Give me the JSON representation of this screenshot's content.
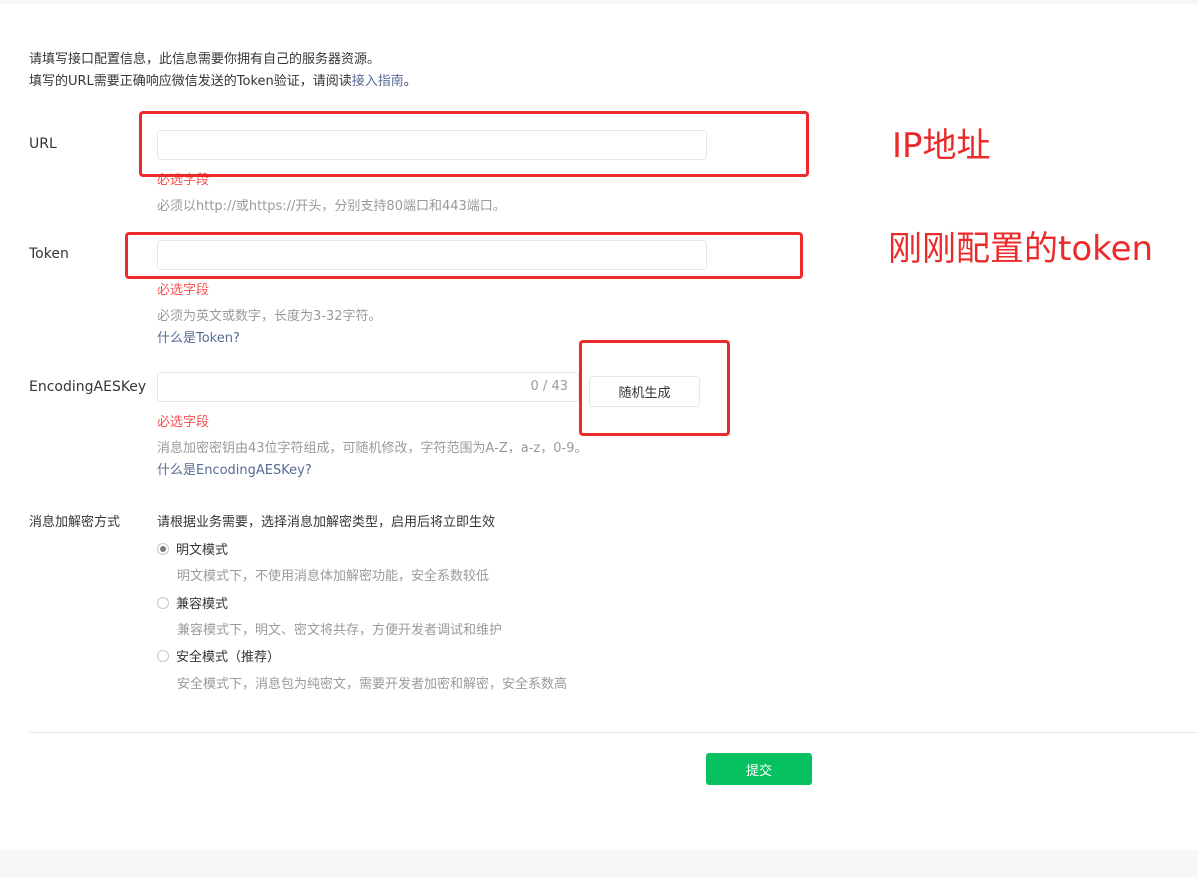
{
  "intro": {
    "line1": "请填写接口配置信息，此信息需要你拥有自己的服务器资源。",
    "line2_prefix": "填写的URL需要正确响应微信发送的Token验证，请阅读",
    "line2_link": "接入指南",
    "line2_suffix": "。"
  },
  "url": {
    "label": "URL",
    "value": "",
    "error": "必选字段",
    "hint": "必须以http://或https://开头，分别支持80端口和443端口。"
  },
  "token": {
    "label": "Token",
    "value": "",
    "error": "必选字段",
    "hint": "必须为英文或数字，长度为3-32字符。",
    "link": "什么是Token?"
  },
  "aes": {
    "label": "EncodingAESKey",
    "value": "",
    "counter": "0 / 43",
    "generate_button": "随机生成",
    "error": "必选字段",
    "hint": "消息加密密钥由43位字符组成，可随机修改，字符范围为A-Z，a-z，0-9。",
    "link": "什么是EncodingAESKey?"
  },
  "encryption": {
    "label": "消息加解密方式",
    "description": "请根据业务需要，选择消息加解密类型，启用后将立即生效",
    "options": [
      {
        "label": "明文模式",
        "desc": "明文模式下，不使用消息体加解密功能，安全系数较低",
        "checked": true
      },
      {
        "label": "兼容模式",
        "desc": "兼容模式下，明文、密文将共存，方便开发者调试和维护",
        "checked": false
      },
      {
        "label": "安全模式（推荐）",
        "desc": "安全模式下，消息包为纯密文，需要开发者加密和解密，安全系数高",
        "checked": false
      }
    ]
  },
  "submit_label": "提交",
  "annotations": {
    "ip_note": "IP地址",
    "token_note": "刚刚配置的token"
  },
  "colors": {
    "error_red": "#fa5151",
    "link_blue": "#576b95",
    "primary_green": "#07c160",
    "annotation_red": "#ec2a2a"
  }
}
